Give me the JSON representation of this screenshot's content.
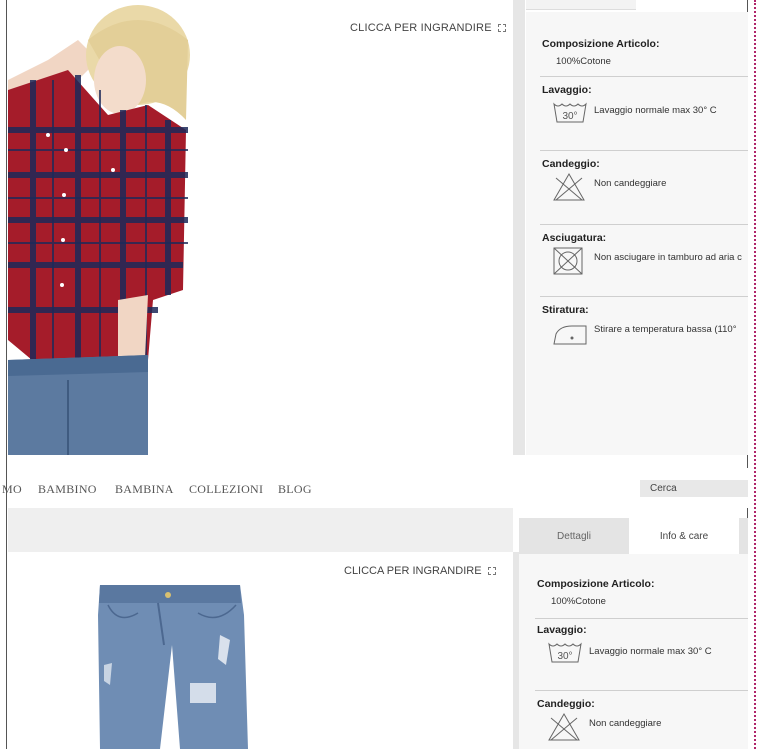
{
  "top_panel": {
    "zoom_label": "CLICCA PER INGRANDIRE",
    "care": {
      "composition": {
        "title": "Composizione Articolo:",
        "value": "100%Cotone"
      },
      "washing": {
        "title": "Lavaggio:",
        "icon_text": "30°",
        "text": "Lavaggio normale max 30° C"
      },
      "bleaching": {
        "title": "Candeggio:",
        "text": "Non candeggiare"
      },
      "drying": {
        "title": "Asciugatura:",
        "text": "Non asciugare in tamburo ad aria c"
      },
      "ironing": {
        "title": "Stiratura:",
        "text": "Stirare a temperatura bassa (110°"
      }
    }
  },
  "nav": {
    "items": [
      "MO",
      "BAMBINO",
      "BAMBINA",
      "COLLEZIONI",
      "BLOG"
    ],
    "search_placeholder": "Cerca"
  },
  "bottom_panel": {
    "zoom_label": "CLICCA PER INGRANDIRE",
    "tabs": [
      "Dettagli",
      "Info & care"
    ],
    "active_tab": "Info & care",
    "care": {
      "composition": {
        "title": "Composizione Articolo:",
        "value": "100%Cotone"
      },
      "washing": {
        "title": "Lavaggio:",
        "icon_text": "30°",
        "text": "Lavaggio normale max 30° C"
      },
      "bleaching": {
        "title": "Candeggio:",
        "text": "Non candeggiare"
      }
    }
  }
}
